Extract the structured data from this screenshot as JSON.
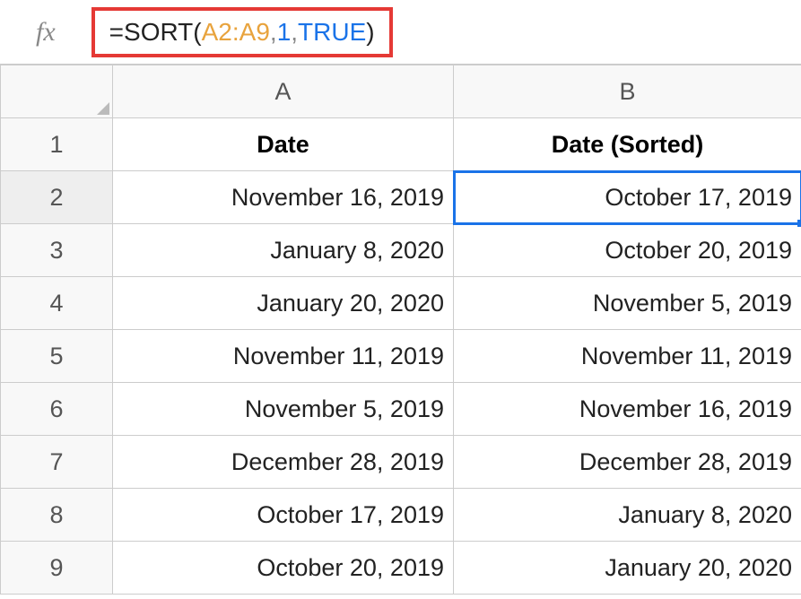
{
  "formula_bar": {
    "fx_label": "fx",
    "formula": {
      "eq": "=",
      "fn": "SORT",
      "open": "(",
      "range": "A2:A9",
      "c1": ",",
      "num": "1",
      "c2": ",",
      "bool": "TRUE",
      "close": ")"
    }
  },
  "columns": [
    "A",
    "B"
  ],
  "row_numbers": [
    "1",
    "2",
    "3",
    "4",
    "5",
    "6",
    "7",
    "8",
    "9"
  ],
  "headers": {
    "a": "Date",
    "b": "Date (Sorted)"
  },
  "rows": [
    {
      "a": "November 16, 2019",
      "b": "October 17, 2019"
    },
    {
      "a": "January 8, 2020",
      "b": "October 20, 2019"
    },
    {
      "a": "January 20, 2020",
      "b": "November 5, 2019"
    },
    {
      "a": "November 11, 2019",
      "b": "November 11, 2019"
    },
    {
      "a": "November 5, 2019",
      "b": "November 16, 2019"
    },
    {
      "a": "December 28, 2019",
      "b": "December 28, 2019"
    },
    {
      "a": "October 17, 2019",
      "b": "January 8, 2020"
    },
    {
      "a": "October 20, 2019",
      "b": "January 20, 2020"
    }
  ],
  "selected_cell": "B2"
}
